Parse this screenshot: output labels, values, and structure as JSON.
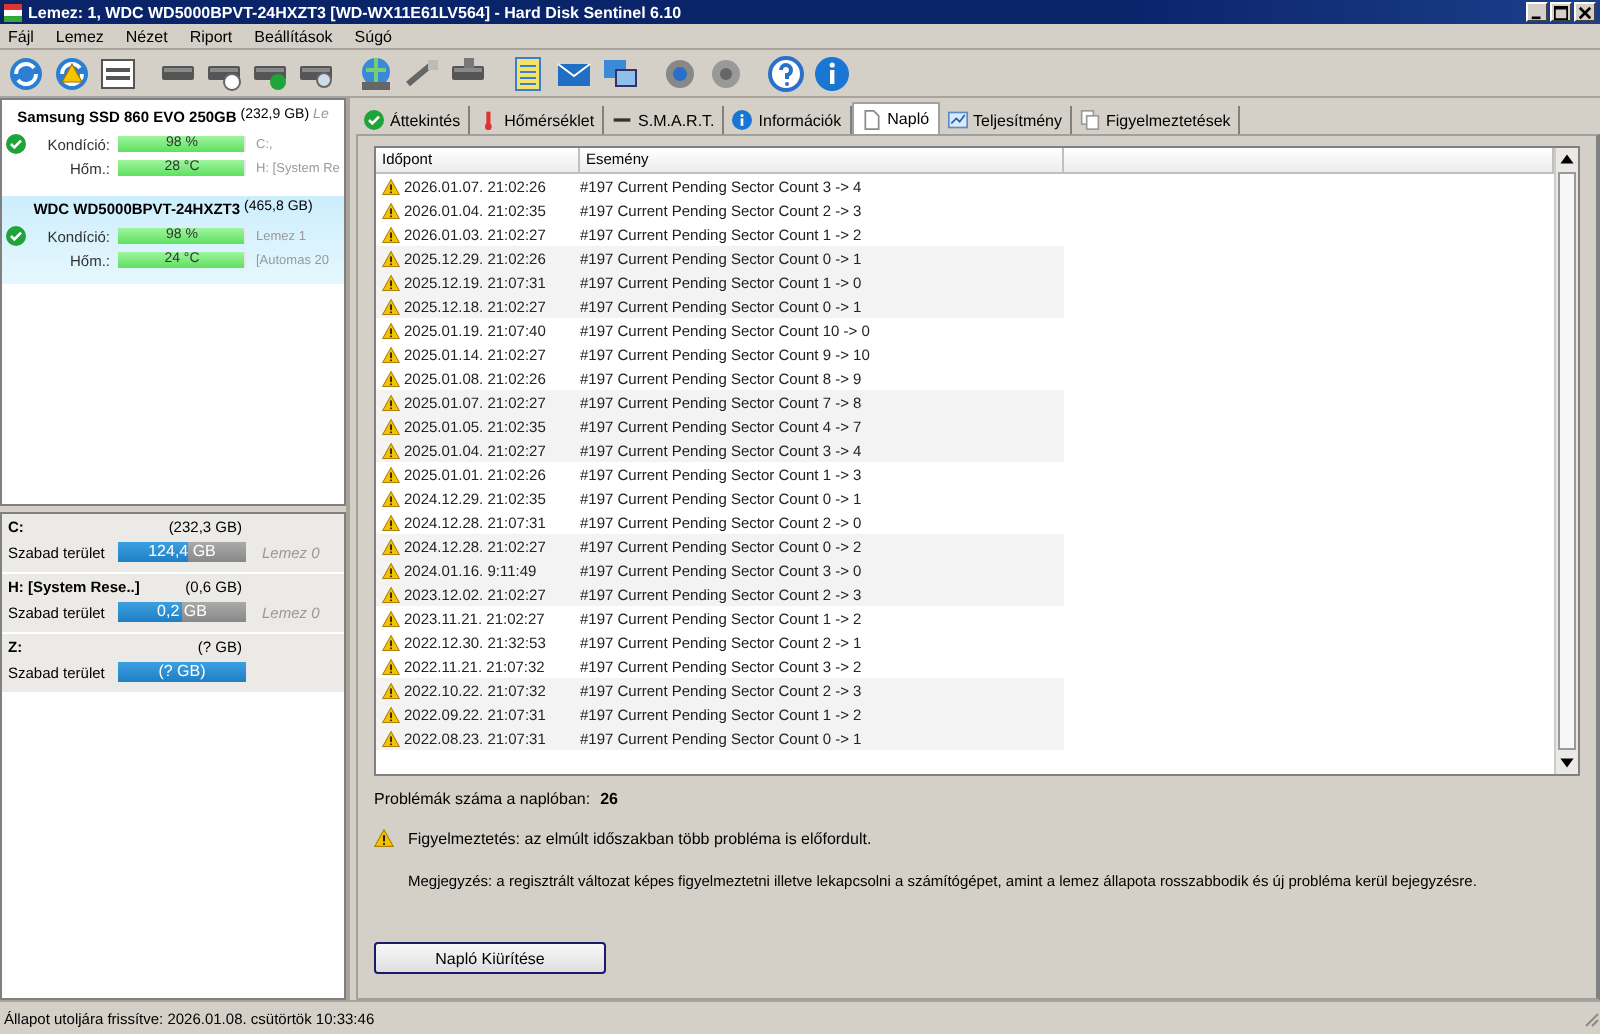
{
  "window": {
    "title": "Lemez: 1, WDC WD5000BPVT-24HXZT3 [WD-WX11E61LV564]  -  Hard Disk Sentinel 6.10"
  },
  "menu": [
    "Fájl",
    "Lemez",
    "Nézet",
    "Riport",
    "Beállítások",
    "Súgó"
  ],
  "disks": [
    {
      "name": "Samsung SSD 860 EVO 250GB",
      "size": "(232,9 GB)",
      "extra": "Le",
      "selected": false,
      "health_label": "Kondíció:",
      "health": {
        "text": "98 %",
        "level": 0.98
      },
      "temp_label": "Hőm.:",
      "temp": {
        "text": "28 °C",
        "level": 0.98
      },
      "side_1": "C:,",
      "side_2": "H: [System Re"
    },
    {
      "name": "WDC WD5000BPVT-24HXZT3",
      "size": "(465,8 GB)",
      "selected": true,
      "health_label": "Kondíció:",
      "health": {
        "text": "98 %",
        "level": 0.98
      },
      "temp_label": "Hőm.:",
      "temp": {
        "text": "24 °C",
        "level": 0.98
      },
      "side_1": "Lemez 1",
      "side_2": "[Automas 20"
    }
  ],
  "partitions": [
    {
      "name": "C:",
      "size": "(232,3 GB)",
      "free_label": "Szabad terület",
      "free": "124,4 GB",
      "level": 0.54,
      "disk": "Lemez 0"
    },
    {
      "name": "H: [System Rese..]",
      "size": "(0,6 GB)",
      "free_label": "Szabad terület",
      "free": "0,2 GB",
      "level": 0.5,
      "disk": "Lemez 0"
    },
    {
      "name": "Z:",
      "size": "(? GB)",
      "free_label": "Szabad terület",
      "free": "(? GB)",
      "level": 1
    }
  ],
  "tabs": [
    {
      "label": "Áttekintés",
      "kind": "check",
      "selected": false
    },
    {
      "label": "Hőmérséklet",
      "kind": "thermometer",
      "selected": false
    },
    {
      "label": "S.M.A.R.T.",
      "kind": "dash",
      "selected": false
    },
    {
      "label": "Információk",
      "kind": "info",
      "selected": false
    },
    {
      "label": "Napló",
      "kind": "document",
      "selected": true
    },
    {
      "label": "Teljesítmény",
      "kind": "chart",
      "selected": false
    },
    {
      "label": "Figyelmeztetések",
      "kind": "copy",
      "selected": false
    }
  ],
  "table": {
    "columns": [
      "Időpont",
      "Esemény"
    ],
    "rows": [
      {
        "time": "2026.01.07. 21:02:26",
        "event": "#197  Current Pending Sector Count  3 -> 4"
      },
      {
        "time": "2026.01.04. 21:02:35",
        "event": "#197  Current Pending Sector Count  2 -> 3"
      },
      {
        "time": "2026.01.03. 21:02:27",
        "event": "#197  Current Pending Sector Count  1 -> 2"
      },
      {
        "time": "2025.12.29. 21:02:26",
        "event": "#197  Current Pending Sector Count  0 -> 1"
      },
      {
        "time": "2025.12.19. 21:07:31",
        "event": "#197  Current Pending Sector Count  1 -> 0"
      },
      {
        "time": "2025.12.18. 21:02:27",
        "event": "#197  Current Pending Sector Count  0 -> 1"
      },
      {
        "time": "2025.01.19. 21:07:40",
        "event": "#197  Current Pending Sector Count  10 -> 0"
      },
      {
        "time": "2025.01.14. 21:02:27",
        "event": "#197  Current Pending Sector Count  9 -> 10"
      },
      {
        "time": "2025.01.08. 21:02:26",
        "event": "#197  Current Pending Sector Count  8 -> 9"
      },
      {
        "time": "2025.01.07. 21:02:27",
        "event": "#197  Current Pending Sector Count  7 -> 8"
      },
      {
        "time": "2025.01.05. 21:02:35",
        "event": "#197  Current Pending Sector Count  4 -> 7"
      },
      {
        "time": "2025.01.04. 21:02:27",
        "event": "#197  Current Pending Sector Count  3 -> 4"
      },
      {
        "time": "2025.01.01. 21:02:26",
        "event": "#197  Current Pending Sector Count  1 -> 3"
      },
      {
        "time": "2024.12.29. 21:02:35",
        "event": "#197  Current Pending Sector Count  0 -> 1"
      },
      {
        "time": "2024.12.28. 21:07:31",
        "event": "#197  Current Pending Sector Count  2 -> 0"
      },
      {
        "time": "2024.12.28. 21:02:27",
        "event": "#197  Current Pending Sector Count  0 -> 2"
      },
      {
        "time": "2024.01.16. 9:11:49",
        "event": "#197  Current Pending Sector Count  3 -> 0"
      },
      {
        "time": "2023.12.02. 21:02:27",
        "event": "#197  Current Pending Sector Count  2 -> 3"
      },
      {
        "time": "2023.11.21. 21:02:27",
        "event": "#197  Current Pending Sector Count  1 -> 2"
      },
      {
        "time": "2022.12.30. 21:32:53",
        "event": "#197  Current Pending Sector Count  2 -> 1"
      },
      {
        "time": "2022.11.21. 21:07:32",
        "event": "#197  Current Pending Sector Count  3 -> 2"
      },
      {
        "time": "2022.10.22. 21:07:32",
        "event": "#197  Current Pending Sector Count  2 -> 3"
      },
      {
        "time": "2022.09.22. 21:07:31",
        "event": "#197  Current Pending Sector Count  1 -> 2"
      },
      {
        "time": "2022.08.23. 21:07:31",
        "event": "#197  Current Pending Sector Count  0 -> 1"
      }
    ]
  },
  "problem_count_label": "Problémák száma a naplóban:",
  "problem_count": "26",
  "warning": "Figyelmeztetés: az elmúlt időszakban több probléma is előfordult.",
  "note": "Megjegyzés: a regisztrált változat képes figyelmeztetni illetve lekapcsolni a számítógépet, amint a lemez állapota rosszabbodik és új probléma kerül bejegyzésre.",
  "clear_button": "Napló Kiürítése",
  "status_bar": "Állapot utoljára frissítve: 2026.01.08. csütörtök 10:33:46"
}
